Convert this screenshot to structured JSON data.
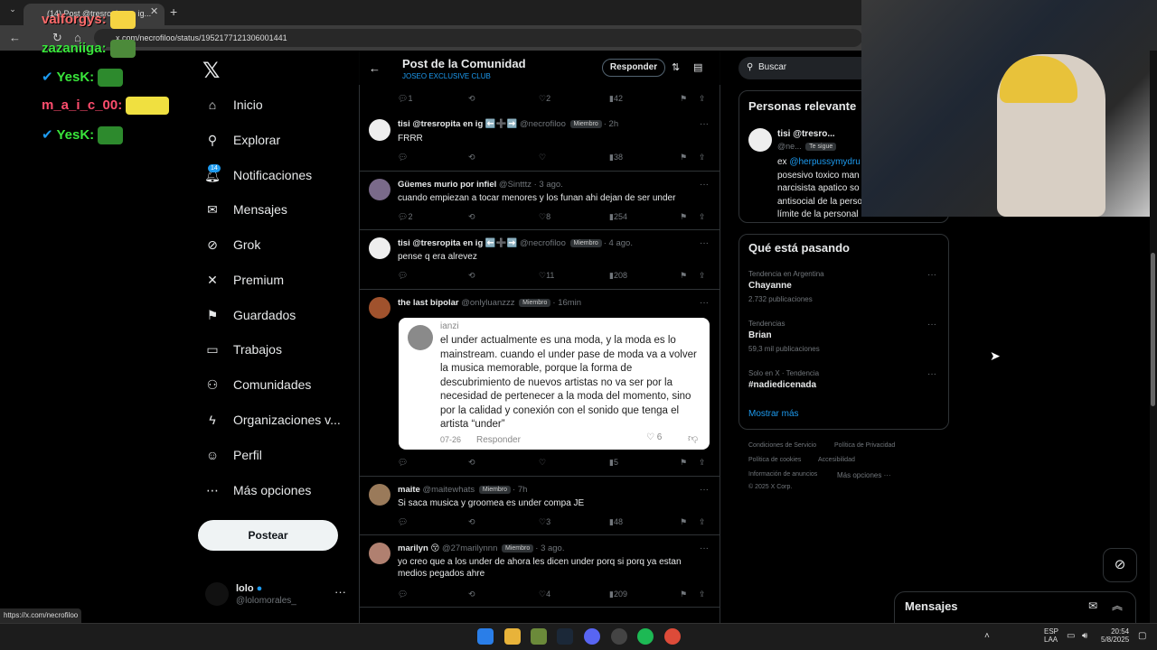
{
  "browser": {
    "tab_title": "(14) Post @tresropita en ig...",
    "url": "x.com/necrofiloo/status/1952177121306001441",
    "status_url": "https://x.com/necrofiloo"
  },
  "chat": [
    {
      "user": "valforgys:"
    },
    {
      "user": "zazaniiga:"
    },
    {
      "user": "YesK:"
    },
    {
      "user": "m_a_i_c_00:"
    },
    {
      "user": "YesK:"
    }
  ],
  "nav": {
    "items": [
      {
        "label": "Inicio",
        "icon": "home-icon"
      },
      {
        "label": "Explorar",
        "icon": "search-icon"
      },
      {
        "label": "Notificaciones",
        "icon": "bell-icon"
      },
      {
        "label": "Mensajes",
        "icon": "envelope-icon"
      },
      {
        "label": "Grok",
        "icon": "grok-icon"
      },
      {
        "label": "Premium",
        "icon": "x-icon"
      },
      {
        "label": "Guardados",
        "icon": "bookmark-icon"
      },
      {
        "label": "Trabajos",
        "icon": "briefcase-icon"
      },
      {
        "label": "Comunidades",
        "icon": "people-icon"
      },
      {
        "label": "Organizaciones v...",
        "icon": "lightning-icon"
      },
      {
        "label": "Perfil",
        "icon": "person-icon"
      },
      {
        "label": "Más opciones",
        "icon": "more-circle-icon"
      }
    ],
    "notif_badge": "14",
    "post_button": "Postear",
    "profile_name": "lolo",
    "profile_handle": "@lolomorales_"
  },
  "header": {
    "title": "Post de la Comunidad",
    "subtitle": "JOSEO EXCLUSIVE CLUB",
    "reply_button": "Responder"
  },
  "posts": [
    {
      "name": "tisi @tresropita en ig ⬅️➕➡️",
      "handle": "@necrofiloo",
      "tag": "Miembro",
      "time": "· 2h",
      "text": "FRRR",
      "replies": "",
      "likes": "",
      "views": "38"
    },
    {
      "name": "Güemes murio por infiel",
      "handle": "@Sintttz",
      "tag": "",
      "time": "· 3 ago.",
      "text": "cuando empiezan a tocar menores y los funan ahi dejan de ser under",
      "replies": "2",
      "likes": "8",
      "views": "254"
    },
    {
      "name": "tisi @tresropita en ig ⬅️➕➡️",
      "handle": "@necrofiloo",
      "tag": "Miembro",
      "time": "· 4 ago.",
      "text": "pense q era alrevez",
      "replies": "",
      "likes": "11",
      "views": "208"
    },
    {
      "name": "the last bipolar",
      "handle": "@onlyluanzzz",
      "tag": "Miembro",
      "time": "· 16min",
      "text": "",
      "replies": "",
      "likes": "",
      "views": "5"
    },
    {
      "name": "maite",
      "handle": "@maitewhats",
      "tag": "Miembro",
      "time": "· 7h",
      "text": "Si saca musica y groomea es under compa JE",
      "replies": "",
      "likes": "3",
      "views": "48"
    },
    {
      "name": "marilyn 😚",
      "handle": "@27marilynnn",
      "tag": "Miembro",
      "time": "· 3 ago.",
      "text": "yo creo que a los under de ahora les dicen under porq si porq ya estan medios pegados ahre",
      "replies": "",
      "likes": "4",
      "views": "209"
    }
  ],
  "top_actions": {
    "replies": "1",
    "likes": "2",
    "views": "42"
  },
  "quote": {
    "user": "ianzi",
    "text": "el under actualmente es una moda, y la moda es lo mainstream. cuando el under pase de moda va a volver la musica memorable, porque la forma de descubrimiento de nuevos artistas no va ser por la necesidad de pertenecer a la moda del momento, sino por la calidad y conexión con el sonido que tenga el artista “under”",
    "date": "07-26",
    "reply": "Responder",
    "likes": "6"
  },
  "right": {
    "search_placeholder": "Buscar",
    "relevant_title": "Personas relevante",
    "relevant_name": "tisi @tresro...",
    "relevant_handle": "@ne...",
    "relevant_follows": "Te sigue",
    "relevant_bio_prefix": "ex ",
    "relevant_bio_link": "@herpussymydru",
    "relevant_bio_lines": [
      "posesivo toxico man",
      "narcisista apatico so",
      "antisocial de la perso",
      "límite de la personal"
    ],
    "trending_title": "Qué está pasando",
    "trends": [
      {
        "context": "Tendencia en Argentina",
        "name": "Chayanne",
        "count": "2.732 publicaciones"
      },
      {
        "context": "Tendencias",
        "name": "Brian",
        "count": "59,3 mil publicaciones"
      },
      {
        "context": "Solo en X · Tendencia",
        "name": "#nadiedicenada",
        "count": ""
      }
    ],
    "show_more": "Mostrar más",
    "footer": [
      "Condiciones de Servicio",
      "Política de Privacidad",
      "Política de cookies",
      "Accesibilidad",
      "Información de anuncios",
      "Más opciones ···",
      "© 2025 X Corp."
    ]
  },
  "messages_dock": {
    "title": "Mensajes"
  },
  "taskbar": {
    "lang": "ESP",
    "lang2": "LAA",
    "time": "20:54",
    "date": "5/8/2025"
  },
  "colors": {
    "accent": "#1d9bf0",
    "bg": "#000000",
    "muted": "#71767b",
    "chat_green": "#39e53b"
  }
}
